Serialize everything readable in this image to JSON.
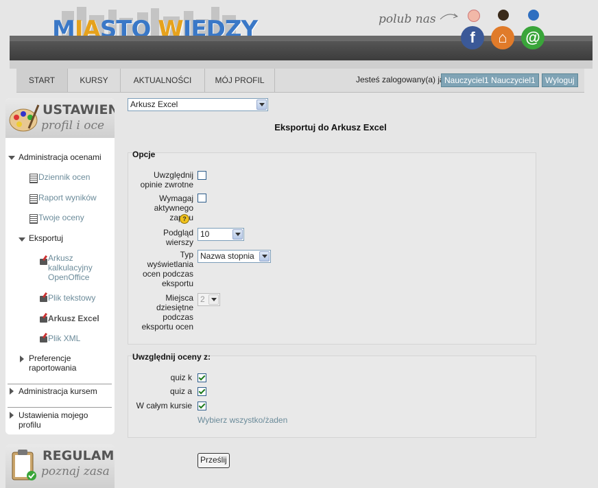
{
  "header": {
    "logo_text": [
      "M",
      "IA",
      "STO ",
      "W",
      "IEDZY"
    ],
    "polub": "polub nas",
    "social": [
      {
        "icon": "facebook-icon",
        "color": "#3b5998",
        "letter": "f"
      },
      {
        "icon": "home-icon",
        "color": "#e07b2a",
        "letter": "⌂"
      },
      {
        "icon": "email-icon",
        "color": "#3aa53a",
        "letter": "@"
      }
    ]
  },
  "nav": {
    "items": [
      "START",
      "KURSY",
      "AKTUALNOŚCI",
      "MÓJ PROFIL"
    ],
    "login_text": "Jesteś zalogowany(a) jako",
    "user_button": "Nauczyciel1 Nauczyciel1",
    "logout_button": "Wyloguj"
  },
  "sidebar": {
    "block1_title": "USTAWIENIA",
    "block1_sub": "profil i oce",
    "admin_grades": "Administracja ocenami",
    "grader_report": "Dziennik ocen",
    "outcomes_report": "Raport wyników",
    "your_grades": "Twoje oceny",
    "export": "Eksportuj",
    "export_ods_1": "Arkusz",
    "export_ods_2": "kalkulacyjny",
    "export_ods_3": "OpenOffice",
    "export_txt": "Plik tekstowy",
    "export_xls": "Arkusz Excel",
    "export_xml": "Plik XML",
    "prefs_1": "Preferencje",
    "prefs_2": "raportowania",
    "course_admin": "Administracja kursem",
    "profile_1": "Ustawienia mojego",
    "profile_2": "profilu",
    "block2_title": "REGULAMINY",
    "block2_sub": "poznaj zasa"
  },
  "main": {
    "export_select": "Arkusz Excel",
    "title": "Eksportuj do Arkusz Excel",
    "options_legend": "Opcje",
    "feedback_1": "Uwzględnij",
    "feedback_2": "opinie zwrotne",
    "active_1": "Wymagaj",
    "active_2": "aktywnego",
    "active_3": "zapisu",
    "preview_1": "Podgląd",
    "preview_2": "wierszy",
    "preview_value": "10",
    "display_1": "Typ",
    "display_2": "wyświetlania",
    "display_3": "ocen podczas",
    "display_4": "eksportu",
    "display_value": "Nazwa stopnia",
    "decimal_1": "Miejsca",
    "decimal_2": "dziesiętne",
    "decimal_3": "podczas",
    "decimal_4": "eksportu ocen",
    "decimal_value": "2",
    "include_legend": "Uwzględnij oceny z:",
    "item1": "quiz k",
    "item2": "quiz a",
    "item3": "W całym kursie",
    "select_all": "Wybierz wszystko/żaden",
    "submit": "Prześlij"
  }
}
